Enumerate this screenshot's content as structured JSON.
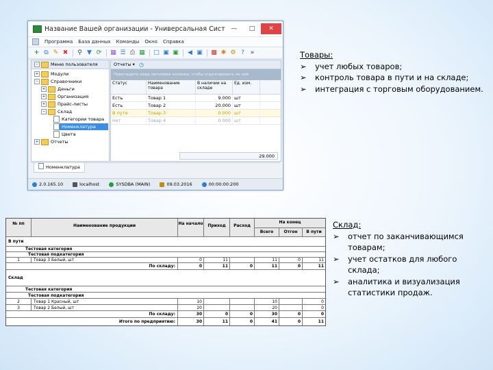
{
  "window": {
    "title": "Название Вашей организации - Универсальная Система Уч...",
    "menu": [
      "Программа",
      "База данных",
      "Команды",
      "Окно",
      "Справка"
    ]
  },
  "left_panel": {
    "title": "Меню пользователя",
    "tree": [
      "Модули",
      "Справочники",
      "Деньги",
      "Организация",
      "Прайс-листы",
      "Склад",
      "Категории товара",
      "Номенклатура",
      "Цвета",
      "Отчеты"
    ]
  },
  "right_panel": {
    "reports_label": "Отчеты",
    "group_hint": "Перетащите сюда заголовок колонки, чтобы сгруппировать по ней",
    "columns": [
      "Статус",
      "Наименование товара",
      "В наличии на складе",
      "Ед. изм."
    ],
    "rows": [
      [
        "Есть",
        "Товар 1",
        "9.000",
        "шт"
      ],
      [
        "Есть",
        "Товар 2",
        "20.000",
        "шт"
      ],
      [
        "В пути",
        "Товар 3",
        "0.000",
        "шт"
      ],
      [
        "Нет",
        "Товар 4",
        "0.000",
        "шт"
      ]
    ],
    "total": "29.000"
  },
  "tab": {
    "label": "Номенклатура"
  },
  "status": {
    "version": "2.0.165.10",
    "host": "localhost",
    "user": "SYSDBA (MAIN)",
    "date": "09.03.2016",
    "time": "00:00:00:200"
  },
  "text_goods": {
    "heading": "Товары:",
    "bullets": [
      "учет любых товаров;",
      "контроль товара в пути и на складе;",
      "интеграция с торговым оборудованием."
    ]
  },
  "text_stock": {
    "heading": "Склад:",
    "bullets": [
      "отчет по заканчивающимся товарам;",
      "учет остатков для любого склада;",
      "аналитика и визуализация статистики продаж."
    ]
  },
  "report": {
    "headers": {
      "no": "№ пп",
      "name": "Наименование продукции",
      "start": "На начало",
      "income": "Приход",
      "expense": "Расход",
      "end": "На конец",
      "total": "Всего",
      "shipped": "Отгон",
      "transit": "В пути"
    },
    "sections": [
      {
        "title": "В пути",
        "category": "Тестовая категория",
        "subcategory": "Тестовая подкатегория",
        "items": [
          {
            "no": "1",
            "name": "Товар 3 Белый, шт",
            "start": "0",
            "income": "11",
            "expense": "",
            "total": "11",
            "shipped": "0",
            "transit": "11"
          }
        ],
        "subtotal": {
          "label": "По складу:",
          "start": "0",
          "income": "11",
          "expense": "0",
          "total": "11",
          "shipped": "0",
          "transit": "11"
        }
      },
      {
        "title": "Склад",
        "category": "Тестовая категория",
        "subcategory": "Тестовая подкатегория",
        "items": [
          {
            "no": "2",
            "name": "Товар 1 Красный, шт",
            "start": "10",
            "income": "",
            "expense": "",
            "total": "10",
            "shipped": "",
            "transit": "0"
          },
          {
            "no": "3",
            "name": "Товар 2 Белый, шт",
            "start": "20",
            "income": "",
            "expense": "",
            "total": "20",
            "shipped": "",
            "transit": "0"
          }
        ],
        "subtotal": {
          "label": "По складу:",
          "start": "30",
          "income": "0",
          "expense": "0",
          "total": "30",
          "shipped": "0",
          "transit": "0"
        }
      }
    ],
    "grand_total": {
      "label": "Итого по предприятию:",
      "start": "30",
      "income": "11",
      "expense": "0",
      "total": "41",
      "shipped": "0",
      "transit": "11"
    }
  }
}
